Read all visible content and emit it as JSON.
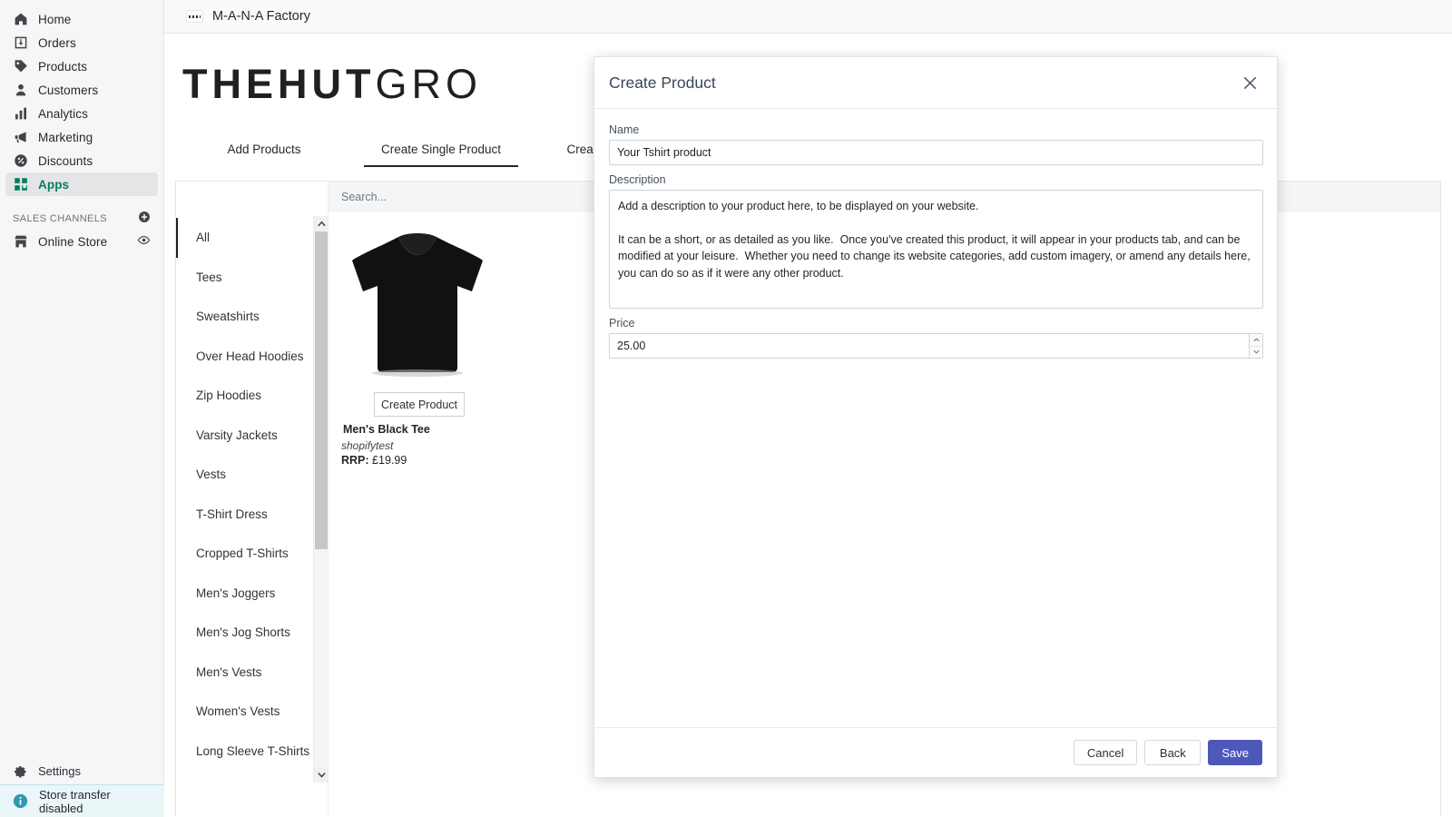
{
  "shopify_nav": {
    "items": [
      {
        "label": "Home",
        "icon": "home-icon"
      },
      {
        "label": "Orders",
        "icon": "orders-icon"
      },
      {
        "label": "Products",
        "icon": "tag-icon"
      },
      {
        "label": "Customers",
        "icon": "person-icon"
      },
      {
        "label": "Analytics",
        "icon": "bar-chart-icon"
      },
      {
        "label": "Marketing",
        "icon": "megaphone-icon"
      },
      {
        "label": "Discounts",
        "icon": "discount-icon"
      },
      {
        "label": "Apps",
        "icon": "apps-icon",
        "active": true
      }
    ],
    "sales_channels": {
      "heading": "SALES CHANNELS",
      "add_icon": "plus-circle-icon",
      "items": [
        {
          "label": "Online Store",
          "icon": "storefront-icon",
          "trailing_icon": "eye-icon"
        }
      ]
    },
    "settings": {
      "label": "Settings",
      "icon": "gear-icon"
    },
    "banner": {
      "label": "Store transfer disabled",
      "icon": "info-icon"
    },
    "accent_color": "#007b5c",
    "active_bg": "#e4e5e7"
  },
  "topbar": {
    "app_name": "M-A-N-A Factory",
    "logo_icon": "mana-logo-icon"
  },
  "app": {
    "brand_logo_bold": "THEHUT",
    "brand_logo_light": "GRO",
    "tabs": [
      {
        "label": "Add Products",
        "active": false
      },
      {
        "label": "Create Single Product",
        "active": true
      },
      {
        "label": "Create Multiple Prod",
        "active": false
      }
    ],
    "search": {
      "placeholder": "Search...",
      "value": ""
    },
    "categories": [
      {
        "label": "All",
        "selected": true
      },
      {
        "label": "Tees",
        "selected": false
      },
      {
        "label": "Sweatshirts",
        "selected": false
      },
      {
        "label": "Over Head Hoodies",
        "selected": false
      },
      {
        "label": "Zip Hoodies",
        "selected": false
      },
      {
        "label": "Varsity Jackets",
        "selected": false
      },
      {
        "label": "Vests",
        "selected": false
      },
      {
        "label": "T-Shirt Dress",
        "selected": false
      },
      {
        "label": "Cropped T-Shirts",
        "selected": false
      },
      {
        "label": "Men's Joggers",
        "selected": false
      },
      {
        "label": "Men's Jog Shorts",
        "selected": false
      },
      {
        "label": "Men's Vests",
        "selected": false
      },
      {
        "label": "Women's Vests",
        "selected": false
      },
      {
        "label": "Long Sleeve T-Shirts",
        "selected": false
      }
    ],
    "product_card": {
      "image_alt": "black-tshirt-image",
      "button_label": "Create Product",
      "title": "Men's Black Tee",
      "vendor": "shopifytest",
      "rrp_label": "RRP:",
      "rrp_value": "£19.99"
    }
  },
  "modal": {
    "title": "Create Product",
    "close_icon": "close-icon",
    "fields": {
      "name_label": "Name",
      "name_value": "Your Tshirt product",
      "description_label": "Description",
      "description_value": "Add a description to your product here, to be displayed on your website.\n\nIt can be a short, or as detailed as you like.  Once you've created this product, it will appear in your products tab, and can be modified at your leisure.  Whether you need to change its website categories, add custom imagery, or amend any details here, you can do so as if it were any other product.",
      "price_label": "Price",
      "price_value": "25.00"
    },
    "buttons": {
      "cancel": "Cancel",
      "back": "Back",
      "save": "Save",
      "save_color": "#4e57ba"
    }
  }
}
